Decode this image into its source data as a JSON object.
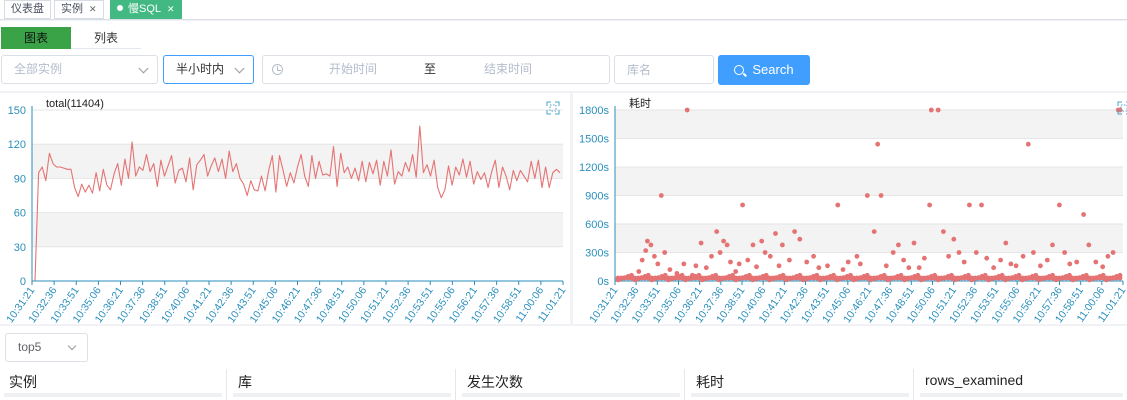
{
  "tabs": [
    {
      "label": "仪表盘",
      "closable": false,
      "active": false
    },
    {
      "label": "实例",
      "closable": true,
      "active": false
    },
    {
      "label": "慢SQL",
      "closable": true,
      "active": true
    }
  ],
  "view_toggle": {
    "chart": "图表",
    "list": "列表",
    "selected": "图表"
  },
  "filters": {
    "instance_placeholder": "全部实例",
    "time_range": "半小时内",
    "start_placeholder": "开始时间",
    "range_separator": "至",
    "end_placeholder": "结束时间",
    "db_placeholder": "库名",
    "search_label": "Search"
  },
  "top_select": "top5",
  "table_headers": [
    "实例",
    "库",
    "发生次数",
    "耗时",
    "rows_examined"
  ],
  "colors": {
    "accent": "#409eff",
    "tab_active": "#42b983",
    "series": "#e57373",
    "toggle_on": "#3aa348",
    "axis": "#2a8fbd"
  },
  "chart_data": [
    {
      "type": "line",
      "title": "total(11404)",
      "ylim": [
        0,
        150
      ],
      "yticks": [
        0,
        30,
        60,
        90,
        120,
        150
      ],
      "grid": "horizontal bands",
      "x_tick_labels": [
        "10:31:21",
        "10:32:36",
        "10:33:51",
        "10:35:06",
        "10:36:21",
        "10:37:36",
        "10:38:51",
        "10:40:06",
        "10:41:21",
        "10:42:36",
        "10:43:51",
        "10:45:06",
        "10:46:21",
        "10:47:36",
        "10:48:51",
        "10:50:06",
        "10:51:21",
        "10:52:36",
        "10:53:51",
        "10:55:06",
        "10:56:21",
        "10:57:36",
        "10:58:51",
        "11:00:06",
        "11:01:21"
      ],
      "values": [
        0,
        95,
        100,
        88,
        112,
        103,
        100,
        100,
        99,
        98,
        98,
        82,
        74,
        85,
        78,
        84,
        77,
        95,
        79,
        98,
        84,
        80,
        94,
        103,
        84,
        107,
        90,
        122,
        92,
        100,
        97,
        111,
        96,
        103,
        83,
        106,
        92,
        101,
        110,
        86,
        97,
        99,
        87,
        108,
        80,
        102,
        106,
        111,
        92,
        101,
        108,
        96,
        107,
        90,
        114,
        96,
        103,
        90,
        85,
        75,
        88,
        80,
        79,
        92,
        79,
        97,
        110,
        78,
        110,
        97,
        83,
        95,
        86,
        100,
        111,
        92,
        83,
        110,
        90,
        105,
        93,
        94,
        92,
        118,
        83,
        112,
        95,
        100,
        90,
        99,
        88,
        105,
        87,
        104,
        94,
        106,
        84,
        105,
        92,
        115,
        85,
        96,
        92,
        104,
        96,
        111,
        91,
        136,
        95,
        102,
        92,
        106,
        82,
        73,
        80,
        101,
        84,
        100,
        93,
        107,
        91,
        105,
        85,
        96,
        89,
        95,
        82,
        96,
        106,
        82,
        100,
        92,
        80,
        97,
        88,
        97,
        92,
        87,
        105,
        90,
        106,
        82,
        100,
        82,
        95,
        98,
        95
      ]
    },
    {
      "type": "scatter",
      "title": "耗时",
      "ylim": [
        0,
        1800
      ],
      "yticks": [
        "0s",
        "300s",
        "600s",
        "900s",
        "1200s",
        "1500s",
        "1800s"
      ],
      "grid": "horizontal bands",
      "x_tick_labels": [
        "10:31:21",
        "10:32:36",
        "10:33:51",
        "10:35:06",
        "10:36:21",
        "10:37:36",
        "10:38:51",
        "10:40:06",
        "10:41:21",
        "10:42:36",
        "10:43:51",
        "10:45:06",
        "10:46:21",
        "10:47:36",
        "10:48:51",
        "10:50:06",
        "10:51:21",
        "10:52:36",
        "10:53:51",
        "10:55:06",
        "10:56:21",
        "10:57:36",
        "10:58:51",
        "11:00:06",
        "11:01:21"
      ],
      "points": [
        [
          1.2,
          100
        ],
        [
          1.4,
          220
        ],
        [
          1.6,
          320
        ],
        [
          1.7,
          420
        ],
        [
          1.9,
          380
        ],
        [
          2.1,
          260
        ],
        [
          2.3,
          180
        ],
        [
          2.5,
          900
        ],
        [
          2.7,
          300
        ],
        [
          3.0,
          120
        ],
        [
          3.4,
          80
        ],
        [
          3.8,
          180
        ],
        [
          4.0,
          1800
        ],
        [
          4.3,
          60
        ],
        [
          4.5,
          160
        ],
        [
          4.8,
          400
        ],
        [
          5.1,
          140
        ],
        [
          5.4,
          260
        ],
        [
          5.7,
          520
        ],
        [
          5.9,
          300
        ],
        [
          6.1,
          420
        ],
        [
          6.3,
          380
        ],
        [
          6.5,
          200
        ],
        [
          6.8,
          100
        ],
        [
          7.0,
          180
        ],
        [
          7.2,
          800
        ],
        [
          7.5,
          220
        ],
        [
          7.8,
          380
        ],
        [
          8.0,
          150
        ],
        [
          8.3,
          420
        ],
        [
          8.5,
          300
        ],
        [
          8.8,
          260
        ],
        [
          9.1,
          500
        ],
        [
          9.3,
          160
        ],
        [
          9.5,
          380
        ],
        [
          9.9,
          220
        ],
        [
          10.2,
          520
        ],
        [
          10.5,
          440
        ],
        [
          10.9,
          200
        ],
        [
          11.3,
          260
        ],
        [
          11.6,
          140
        ],
        [
          12.1,
          160
        ],
        [
          12.7,
          800
        ],
        [
          13.0,
          120
        ],
        [
          13.3,
          200
        ],
        [
          13.8,
          260
        ],
        [
          14.0,
          180
        ],
        [
          14.4,
          900
        ],
        [
          14.8,
          520
        ],
        [
          15.0,
          1440
        ],
        [
          15.2,
          900
        ],
        [
          15.5,
          160
        ],
        [
          15.9,
          300
        ],
        [
          16.2,
          380
        ],
        [
          16.5,
          220
        ],
        [
          16.8,
          140
        ],
        [
          17.1,
          400
        ],
        [
          17.4,
          140
        ],
        [
          17.7,
          240
        ],
        [
          18.0,
          800
        ],
        [
          18.1,
          1800
        ],
        [
          18.5,
          1800
        ],
        [
          18.8,
          520
        ],
        [
          19.1,
          260
        ],
        [
          19.4,
          440
        ],
        [
          19.7,
          300
        ],
        [
          20.0,
          200
        ],
        [
          20.3,
          800
        ],
        [
          20.7,
          300
        ],
        [
          21.0,
          800
        ],
        [
          21.3,
          240
        ],
        [
          21.7,
          140
        ],
        [
          22.1,
          220
        ],
        [
          22.4,
          400
        ],
        [
          22.7,
          180
        ],
        [
          23.0,
          160
        ],
        [
          23.4,
          260
        ],
        [
          23.7,
          1440
        ],
        [
          24.0,
          300
        ],
        [
          24.4,
          160
        ],
        [
          24.8,
          220
        ],
        [
          25.1,
          380
        ],
        [
          25.5,
          800
        ],
        [
          25.8,
          300
        ],
        [
          26.1,
          180
        ],
        [
          26.5,
          200
        ],
        [
          26.9,
          700
        ],
        [
          27.2,
          380
        ],
        [
          27.6,
          200
        ],
        [
          28.0,
          150
        ],
        [
          28.3,
          260
        ],
        [
          28.6,
          300
        ],
        [
          28.9,
          1800
        ],
        [
          29.0,
          1800
        ]
      ]
    }
  ]
}
